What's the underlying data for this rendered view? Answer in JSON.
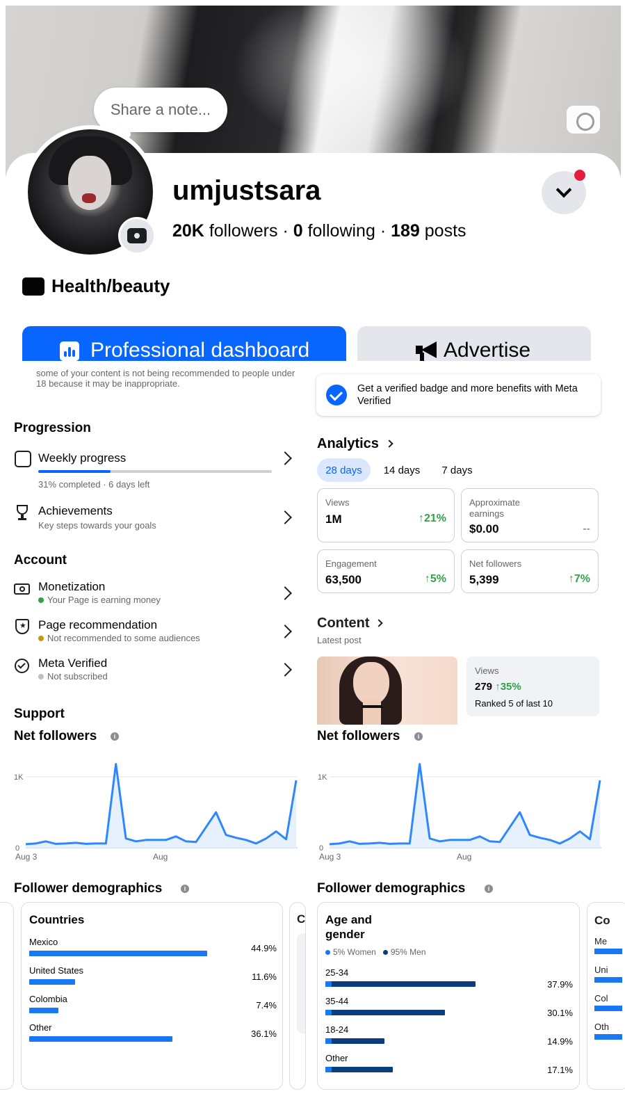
{
  "profile": {
    "note_placeholder": "Share a note...",
    "username": "umjustsara",
    "followers_count": "20K",
    "followers_label": "followers",
    "following_count": "0",
    "following_label": "following",
    "posts_count": "189",
    "posts_label": "posts",
    "separator": "·",
    "category": "Health/beauty"
  },
  "actions": {
    "professional_dashboard": "Professional dashboard",
    "advertise": "Advertise"
  },
  "notice_text": "some of your content is not being recommended to people under 18 because it may be inappropriate.",
  "progression": {
    "title": "Progression",
    "weekly_title": "Weekly progress",
    "weekly_sub": "31% completed · 6 days left",
    "weekly_progress_percent": 31,
    "achievements_title": "Achievements",
    "achievements_sub": "Key steps towards your goals"
  },
  "account": {
    "title": "Account",
    "items": [
      {
        "title": "Monetization",
        "sub": "Your Page is earning money",
        "dot_color": "#31a24c"
      },
      {
        "title": "Page recommendation",
        "sub": "Not recommended to some audiences",
        "dot_color": "#c29a0a"
      },
      {
        "title": "Meta Verified",
        "sub": "Not subscribed",
        "dot_color": "#bcc0c4"
      }
    ]
  },
  "support_title": "Support",
  "verified_promo": "Get a verified badge and more benefits with Meta Verified",
  "analytics": {
    "title": "Analytics",
    "ranges": [
      "28 days",
      "14 days",
      "7 days"
    ],
    "active_range": "28 days",
    "metrics": [
      {
        "label": "Views",
        "value": "1M",
        "change": "↑21%"
      },
      {
        "label": "Approximate earnings",
        "value": "$0.00",
        "change": "--"
      },
      {
        "label": "Engagement",
        "value": "63,500",
        "change": "↑5%"
      },
      {
        "label": "Net followers",
        "value": "5,399",
        "change": "↑7%"
      }
    ]
  },
  "content": {
    "title": "Content",
    "subtitle": "Latest post",
    "views_label": "Views",
    "views_value": "279",
    "views_change": "↑35%",
    "rank": "Ranked 5 of last 10"
  },
  "net_followers": {
    "title": "Net followers",
    "info_glyph": "i"
  },
  "chart_data": [
    {
      "type": "area",
      "title": "Net followers",
      "y_ticks": [
        "1K",
        "0"
      ],
      "ylim": [
        0,
        1000
      ],
      "x_ticks": [
        "Aug 3",
        "Aug"
      ],
      "values": [
        50,
        60,
        90,
        55,
        60,
        70,
        55,
        60,
        60,
        1180,
        130,
        90,
        110,
        110,
        110,
        160,
        90,
        80,
        290,
        500,
        180,
        140,
        110,
        60,
        130,
        230,
        120,
        950
      ],
      "grid": true
    },
    {
      "type": "area",
      "title": "Net followers",
      "y_ticks": [
        "1K",
        "0"
      ],
      "ylim": [
        0,
        1000
      ],
      "x_ticks": [
        "Aug 3",
        "Aug"
      ],
      "values": [
        50,
        60,
        90,
        55,
        60,
        70,
        55,
        60,
        60,
        1180,
        130,
        90,
        110,
        110,
        110,
        160,
        90,
        80,
        290,
        500,
        180,
        140,
        110,
        60,
        130,
        230,
        120,
        950
      ],
      "grid": true
    }
  ],
  "demographics": {
    "title": "Follower demographics",
    "countries": {
      "title": "Countries",
      "rows": [
        {
          "label": "Mexico",
          "pct_text": "44.9%",
          "pct": 44.9
        },
        {
          "label": "United States",
          "pct_text": "11.6%",
          "pct": 11.6
        },
        {
          "label": "Colombia",
          "pct_text": "7.4%",
          "pct": 7.4
        },
        {
          "label": "Other",
          "pct_text": "36.1%",
          "pct": 36.1
        }
      ]
    },
    "age_gender": {
      "title": "Age and gender",
      "legend_women": "5% Women",
      "legend_men": "95% Men",
      "rows": [
        {
          "label": "25-34",
          "pct_text": "37.9%",
          "pct": 37.9
        },
        {
          "label": "35-44",
          "pct_text": "30.1%",
          "pct": 30.1
        },
        {
          "label": "18-24",
          "pct_text": "14.9%",
          "pct": 14.9
        },
        {
          "label": "Other",
          "pct_text": "17.1%",
          "pct": 17.1
        }
      ]
    },
    "peek_letter_left": "C",
    "peek_right_title": "Co",
    "peek_right_rows": [
      "Me",
      "Uni",
      "Col",
      "Oth"
    ]
  },
  "colors": {
    "accent": "#0866ff",
    "positive": "#31a24c",
    "bar_light": "#1877f2",
    "bar_dark": "#0b3d7a",
    "chart_line": "#2d88ff",
    "chart_fill": "#e7f0fd"
  }
}
